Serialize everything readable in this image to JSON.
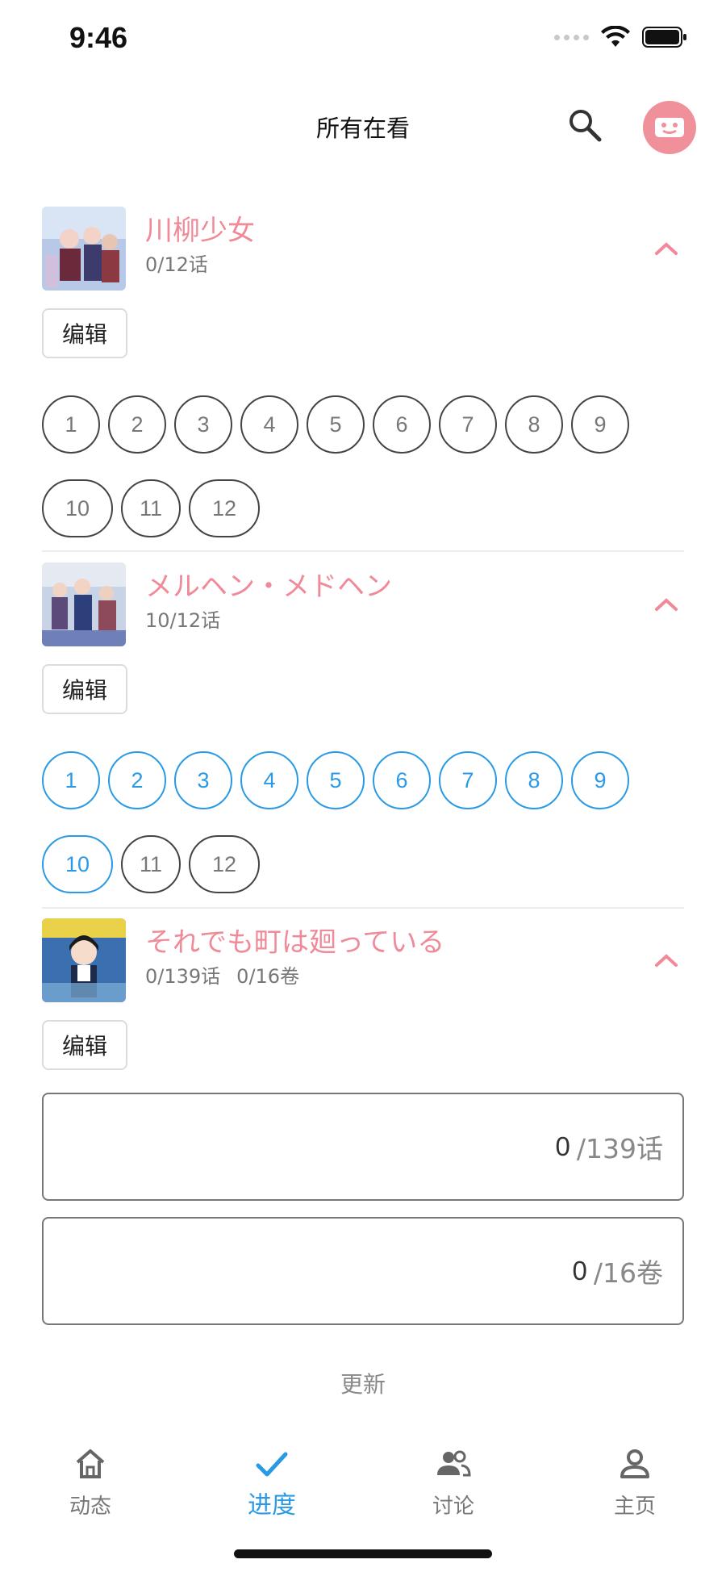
{
  "status_bar": {
    "time": "9:46"
  },
  "header": {
    "title": "所有在看"
  },
  "items": [
    {
      "title": "川柳少女",
      "progress": "0/12话",
      "edit_label": "编辑",
      "episodes": [
        "1",
        "2",
        "3",
        "4",
        "5",
        "6",
        "7",
        "8",
        "9",
        "10",
        "11",
        "12"
      ],
      "watched_count": 0
    },
    {
      "title": "メルヘン・メドヘン",
      "progress": "10/12话",
      "edit_label": "编辑",
      "episodes": [
        "1",
        "2",
        "3",
        "4",
        "5",
        "6",
        "7",
        "8",
        "9",
        "10",
        "11",
        "12"
      ],
      "watched_count": 10
    },
    {
      "title": "それでも町は廻っている",
      "progress_chapters": "0/139话",
      "progress_volumes": "0/16卷",
      "edit_label": "编辑",
      "chapters": {
        "value": "0",
        "total": "/139话"
      },
      "volumes": {
        "value": "0",
        "total": "/16卷"
      }
    }
  ],
  "update_label": "更新",
  "tab_bar": {
    "tabs": [
      {
        "label": "动态",
        "icon": "home-icon",
        "active": false
      },
      {
        "label": "进度",
        "icon": "check-icon",
        "active": true
      },
      {
        "label": "讨论",
        "icon": "people-icon",
        "active": false
      },
      {
        "label": "主页",
        "icon": "person-icon",
        "active": false
      }
    ]
  },
  "colors": {
    "accent_pink": "#f08a99",
    "accent_blue": "#2a9ae6",
    "avatar_bg": "#f0909b"
  }
}
